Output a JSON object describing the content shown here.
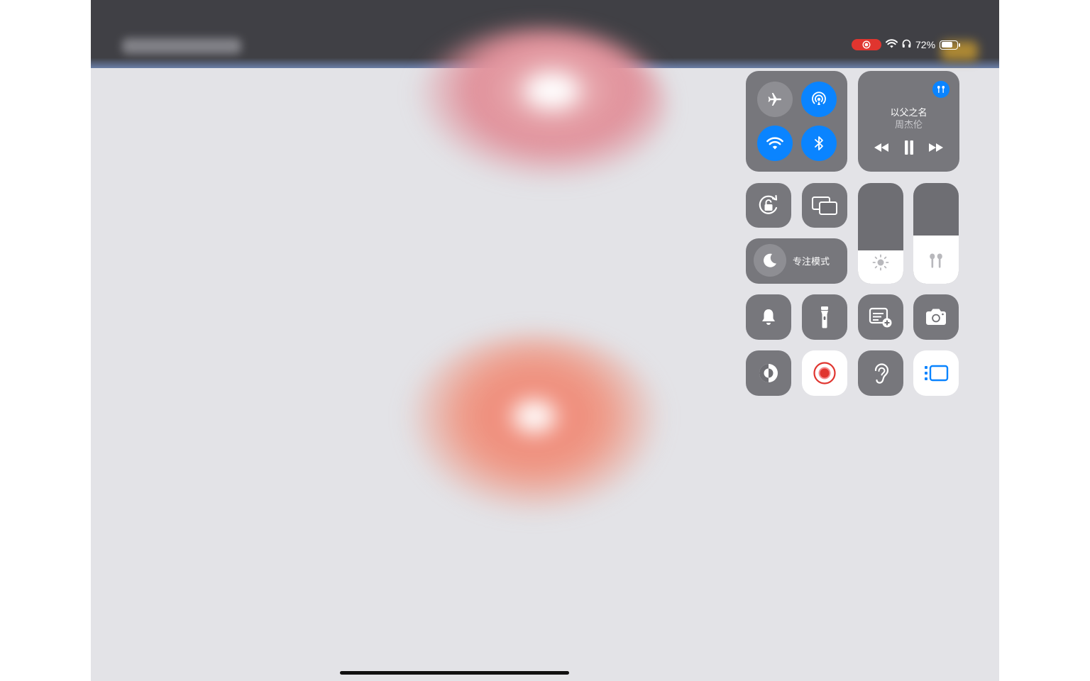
{
  "status_bar": {
    "battery_percent": "72%",
    "battery_level": 0.72,
    "recording_indicator": "screen-recording-icon",
    "icons": [
      "wifi-icon",
      "headphones-icon",
      "battery-icon"
    ]
  },
  "background": {
    "blurred_title": "blurred-app-title",
    "content": "blurred-lips-illustration"
  },
  "control_center": {
    "connectivity": {
      "airplane_mode": {
        "icon": "airplane-icon",
        "on": false
      },
      "airdrop": {
        "icon": "airdrop-icon",
        "on": true
      },
      "wifi": {
        "icon": "wifi-icon",
        "on": true
      },
      "bluetooth": {
        "icon": "bluetooth-icon",
        "on": true
      }
    },
    "now_playing": {
      "title": "以父之名",
      "artist": "周杰伦",
      "output_icon": "airpods-icon",
      "controls": [
        "rewind-icon",
        "pause-icon",
        "fast-forward-icon"
      ]
    },
    "orientation_lock": {
      "icon": "rotation-lock-icon"
    },
    "screen_mirroring": {
      "icon": "screen-mirroring-icon"
    },
    "focus": {
      "label": "专注模式",
      "icon": "moon-icon"
    },
    "brightness": {
      "level": 0.33,
      "icon": "sun-icon"
    },
    "volume": {
      "level": 0.48,
      "icon": "airpods-icon"
    },
    "row3": [
      "bell-icon",
      "flashlight-icon",
      "quick-note-icon",
      "camera-icon"
    ],
    "row4": [
      "dark-mode-icon",
      "screen-record-icon",
      "hearing-icon",
      "stage-manager-icon"
    ]
  },
  "colors": {
    "accent_blue": "#0a84ff",
    "record_red": "#e0352f",
    "tile_gray": "#6e6e73"
  }
}
